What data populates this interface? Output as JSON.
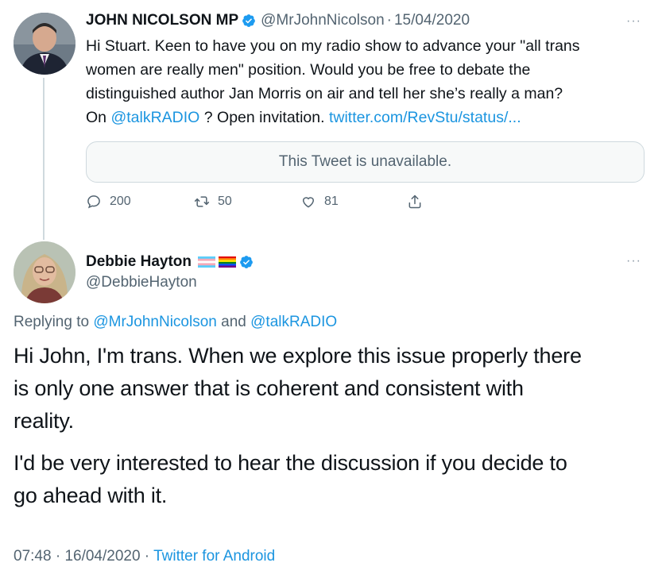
{
  "tweet1": {
    "name": "JOHN NICOLSON MP",
    "handle": "@MrJohnNicolson",
    "separator": "·",
    "date": "15/04/2020",
    "more": "···",
    "text_line1": "Hi Stuart. Keen to have you on my radio show to advance your \"all trans",
    "text_line2": "women are really men\" position. Would you be free to debate the",
    "text_line3": "distinguished author Jan Morris on air and tell her she’s really a man?",
    "text_line4_pre": "On ",
    "text_mention": "@talkRADIO",
    "text_line4_mid": " ? Open invitation. ",
    "text_link": "twitter.com/RevStu/status/...",
    "quote_unavailable": "This Tweet is unavailable.",
    "replies": "200",
    "retweets": "50",
    "likes": "81"
  },
  "tweet2": {
    "name": "Debbie Hayton",
    "handle": "@DebbieHayton",
    "more": "···",
    "replying_prefix": "Replying to ",
    "replying_user1": "@MrJohnNicolson",
    "replying_and": " and ",
    "replying_user2": "@talkRADIO",
    "para1_line1": "Hi John, I'm trans. When we explore this issue properly there",
    "para1_line2": "is only one answer that is coherent and consistent with",
    "para1_line3": "reality.",
    "para2_line1": "I'd be very interested to hear the discussion if you decide to",
    "para2_line2": "go ahead with it.",
    "time": "07:48",
    "separator": " · ",
    "date": "16/04/2020",
    "source": "Twitter for Android"
  },
  "colors": {
    "link": "#1b95e0",
    "muted": "#536471",
    "verified": "#1d9bf0",
    "border": "#cfd9de"
  },
  "icons": [
    "verified-badge-icon",
    "reply-icon",
    "retweet-icon",
    "like-icon",
    "share-icon",
    "more-icon",
    "trans-flag-icon",
    "rainbow-flag-icon"
  ]
}
